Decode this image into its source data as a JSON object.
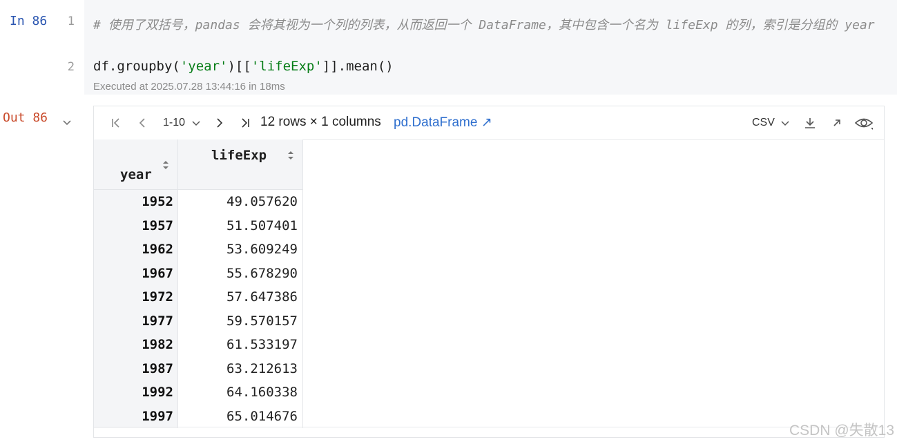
{
  "input_cell": {
    "prompt": "In 86",
    "line_numbers": [
      "1",
      "2"
    ],
    "comment": "# 使用了双括号，pandas 会将其视为一个列的列表，从而返回一个 DataFrame，其中包含一个名为 lifeExp 的列，索引是分组的 year",
    "code": {
      "part1": "df.groupby(",
      "str1": "'year'",
      "part2": ")[[",
      "str2": "'lifeExp'",
      "part3": "]].mean()"
    },
    "exec_info": "Executed at 2025.07.28 13:44:16 in 18ms"
  },
  "output_cell": {
    "prompt": "Out 86",
    "toolbar": {
      "range": "1-10",
      "summary": "12 rows × 1 columns",
      "type_link": "pd.DataFrame ↗",
      "export_format": "CSV"
    },
    "table": {
      "index_name": "year",
      "columns": [
        "lifeExp"
      ],
      "rows": [
        {
          "index": "1952",
          "value": "49.057620"
        },
        {
          "index": "1957",
          "value": "51.507401"
        },
        {
          "index": "1962",
          "value": "53.609249"
        },
        {
          "index": "1967",
          "value": "55.678290"
        },
        {
          "index": "1972",
          "value": "57.647386"
        },
        {
          "index": "1977",
          "value": "59.570157"
        },
        {
          "index": "1982",
          "value": "61.533197"
        },
        {
          "index": "1987",
          "value": "63.212613"
        },
        {
          "index": "1992",
          "value": "64.160338"
        },
        {
          "index": "1997",
          "value": "65.014676"
        }
      ]
    }
  },
  "watermark": "CSDN @失散13",
  "icons": [
    "first-page-icon",
    "prev-page-icon",
    "chevron-down-icon",
    "next-page-icon",
    "last-page-icon",
    "download-icon",
    "open-external-icon",
    "eye-icon",
    "sort-icon"
  ],
  "colors": {
    "in_prompt": "#2a55b0",
    "out_prompt": "#c94a2a",
    "string": "#067d17",
    "link": "#2f6fce",
    "code_bg": "#f6f7f9"
  }
}
